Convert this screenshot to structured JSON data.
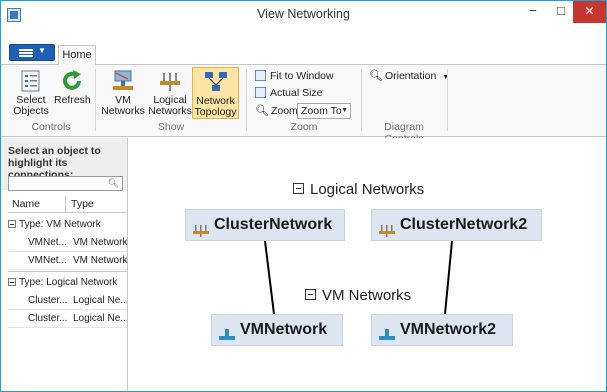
{
  "window": {
    "title": "View Networking",
    "controls": {
      "minimize": "−",
      "maximize": "□",
      "close": "✕"
    }
  },
  "tabs": {
    "home": "Home"
  },
  "ribbon": {
    "select_objects": "Select Objects",
    "refresh": "Refresh",
    "vm_networks": "VM Networks",
    "logical_networks": "Logical Networks",
    "network_topology": "Network Topology",
    "fit_to_window": "Fit to Window",
    "actual_size": "Actual Size",
    "zoom_label": "Zoom",
    "zoom_value": "Zoom To",
    "orientation": "Orientation",
    "groups": {
      "controls": "Controls",
      "show": "Show",
      "zoom": "Zoom",
      "diagram_controls": "Diagram Controls"
    }
  },
  "left_panel": {
    "prompt": "Select an object to highlight its connections:",
    "search_value": "",
    "columns": {
      "name": "Name",
      "type": "Type"
    },
    "groups": [
      {
        "label": "Type:  VM Network",
        "rows": [
          {
            "name": "VMNet...",
            "type": "VM Network"
          },
          {
            "name": "VMNet...",
            "type": "VM Network"
          }
        ]
      },
      {
        "label": "Type:  Logical Network",
        "rows": [
          {
            "name": "Cluster...",
            "type": "Logical Ne..."
          },
          {
            "name": "Cluster...",
            "type": "Logical Ne..."
          }
        ]
      }
    ]
  },
  "diagram": {
    "logical_header": "Logical Networks",
    "vm_header": "VM Networks",
    "logical_nodes": [
      "ClusterNetwork",
      "ClusterNetwork2"
    ],
    "vm_nodes": [
      "VMNetwork",
      "VMNetwork2"
    ]
  },
  "colors": {
    "accent": "#19a0d8",
    "close_button": "#c7372f",
    "selected_ribbon": "#fce4a5",
    "node_fill": "#dde6f0"
  }
}
